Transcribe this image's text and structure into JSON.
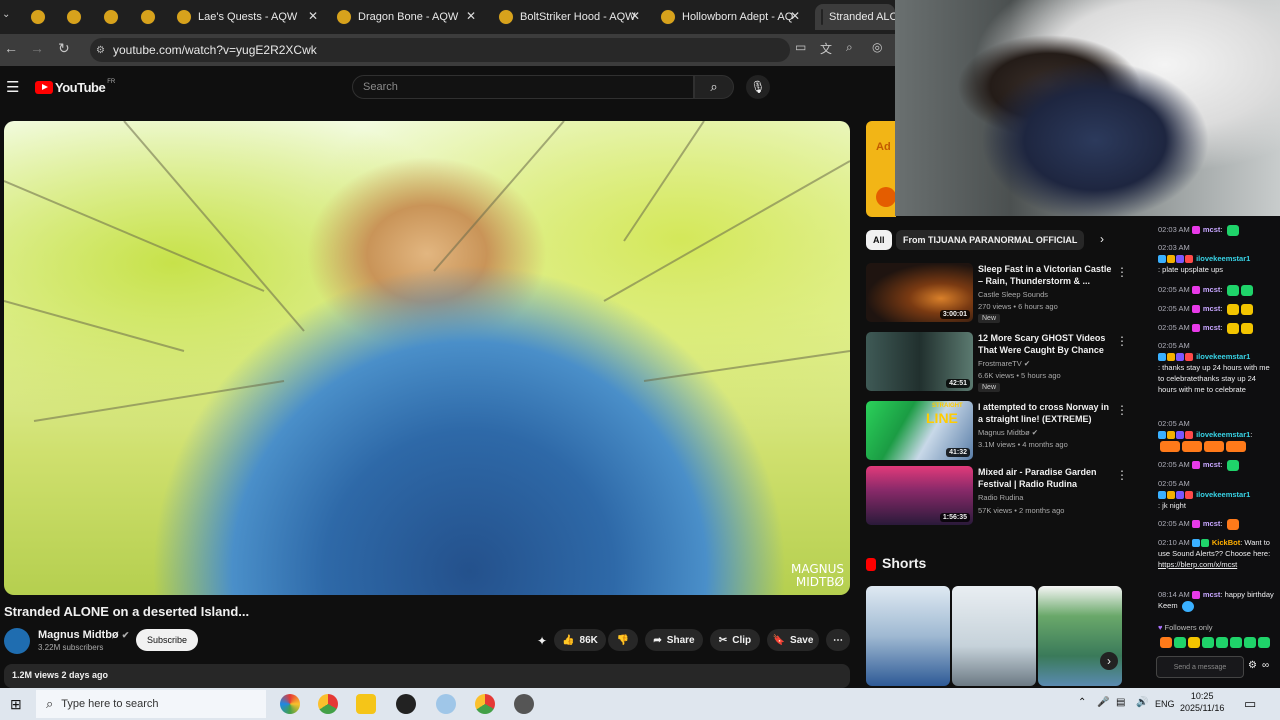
{
  "browser": {
    "tabs": [
      {
        "label": ""
      },
      {
        "label": ""
      },
      {
        "label": ""
      },
      {
        "label": ""
      },
      {
        "label": "Lae's Quests - AQW"
      },
      {
        "label": "Dragon Bone - AQW"
      },
      {
        "label": "BoltStriker Hood - AQW"
      },
      {
        "label": "Hollowborn Adept - AQ"
      },
      {
        "label": "Stranded ALC"
      }
    ],
    "url": "youtube.com/watch?v=yugE2R2XCwk"
  },
  "youtube": {
    "logo": "YouTube",
    "logo_suffix": "FR",
    "search_placeholder": "Search"
  },
  "video": {
    "watermark_line1": "MAGNUS",
    "watermark_line2": "MIDTBØ",
    "title": "Stranded ALONE on a deserted Island...",
    "channel": "Magnus Midtbø",
    "subscribers": "3.22M subscribers",
    "subscribe_label": "Subscribe",
    "likes": "86K",
    "share_label": "Share",
    "clip_label": "Clip",
    "save_label": "Save",
    "views_date": "1.2M views  2 days ago"
  },
  "sidebar": {
    "ad_text": "Ad",
    "chips": [
      "All",
      "From TIJUANA PARANORMAL OFFICIAL"
    ],
    "recommendations": [
      {
        "title": "Sleep Fast in a Victorian Castle – Rain, Thunderstorm & ...",
        "channel": "Castle Sleep Sounds",
        "meta": "270 views • 6 hours ago",
        "badge": "New",
        "duration": "3:00:01"
      },
      {
        "title": "12 More Scary GHOST Videos That Were Caught By Chance",
        "channel": "FrostmareTV",
        "meta": "6.6K views • 5 hours ago",
        "badge": "New",
        "duration": "42:51"
      },
      {
        "title": "I attempted to cross Norway in a straight line! (EXTREME)",
        "channel": "Magnus Midtbø",
        "meta": "3.1M views • 4 months ago",
        "badge": "",
        "duration": "41:32"
      },
      {
        "title": "Mixed air - Paradise Garden Festival | Radio Rudina",
        "channel": "Radio Rudina",
        "meta": "57K views • 2 months ago",
        "badge": "",
        "duration": "1:56:35"
      }
    ],
    "shorts_heading": "Shorts",
    "thumb_text_line": "LINE",
    "thumb_text_straight": "STRAIGHT"
  },
  "chat": {
    "messages": [
      {
        "time": "02:03 AM",
        "user": "mcst",
        "text": ":"
      },
      {
        "time": "02:03 AM",
        "user": "ilovekeemstar1",
        "text": ": plate upsplate ups"
      },
      {
        "time": "02:05 AM",
        "user": "mcst",
        "text": ":"
      },
      {
        "time": "02:05 AM",
        "user": "mcst",
        "text": ":"
      },
      {
        "time": "02:05 AM",
        "user": "mcst",
        "text": ":"
      },
      {
        "time": "02:05 AM",
        "user": "ilovekeemstar1",
        "text": ": thanks stay up 24 hours with me to celebratethanks stay up 24 hours with me to celebrate"
      },
      {
        "time": "02:05 AM",
        "user": "ilovekeemstar1",
        "text": ":"
      },
      {
        "time": "02:05 AM",
        "user": "mcst",
        "text": ":"
      },
      {
        "time": "02:05 AM",
        "user": "ilovekeemstar1",
        "text": ": jk night"
      },
      {
        "time": "02:05 AM",
        "user": "mcst",
        "text": ":"
      },
      {
        "time": "02:10 AM",
        "user": "KickBot",
        "text": ": Want to use Sound Alerts?? Choose here:"
      },
      {
        "time": "",
        "user": "",
        "text": "https://blerp.com/x/mcst"
      },
      {
        "time": "08:14 AM",
        "user": "mcst",
        "text": ": happy birthday Keem"
      }
    ],
    "followers_only": "Followers only",
    "input_placeholder": "Send a message"
  },
  "taskbar": {
    "search_placeholder": "Type here to search",
    "lang": "ENG",
    "time": "10:25",
    "date": "2025/11/16"
  }
}
